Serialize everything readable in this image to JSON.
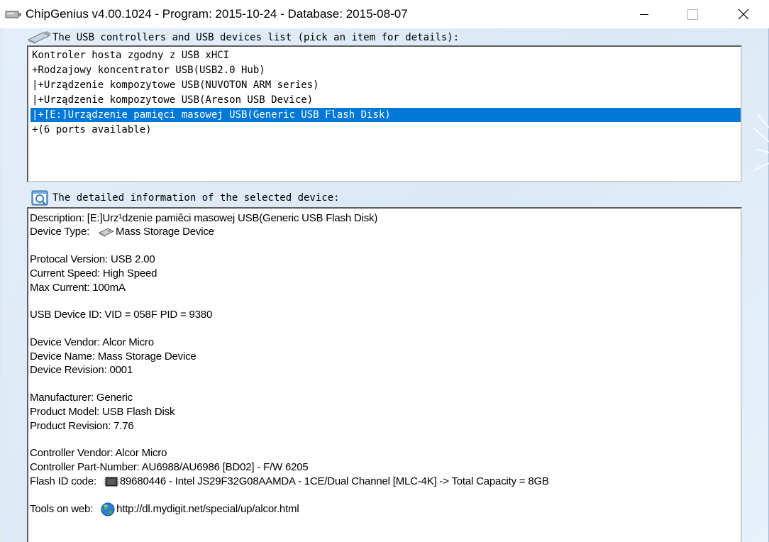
{
  "window": {
    "title": "ChipGenius v4.00.1024 - Program: 2015-10-24 - Database: 2015-08-07"
  },
  "list_section": {
    "label": "The USB controllers and USB devices list (pick an item for details):",
    "items": [
      "Kontroler hosta zgodny z USB xHCI",
      "+Rodzajowy koncentrator USB(USB2.0 Hub)",
      "|+Urządzenie kompozytowe USB(NUVOTON ARM series)",
      "|+Urządzenie kompozytowe USB(Areson USB Device)",
      "|+[E:]Urządzenie pamięci masowej USB(Generic USB Flash Disk)",
      "+(6 ports available)"
    ],
    "selected_index": 4
  },
  "detail_section": {
    "label": "The detailed information of the selected device:",
    "lines": {
      "description": "Description: [E:]Urz¹dzenie pamiêci masowej USB(Generic USB Flash Disk)",
      "device_type_label": "Device Type:",
      "device_type_value": "Mass Storage Device",
      "protocol_version": "Protocal Version: USB 2.00",
      "current_speed": "Current Speed: High Speed",
      "max_current": "Max Current: 100mA",
      "usb_device_id": "USB Device ID: VID = 058F PID = 9380",
      "device_vendor": "Device Vendor: Alcor Micro",
      "device_name": "Device Name: Mass Storage Device",
      "device_revision": "Device Revision: 0001",
      "manufacturer": "Manufacturer: Generic",
      "product_model": "Product Model: USB Flash Disk",
      "product_revision": "Product Revision: 7.76",
      "controller_vendor": "Controller Vendor: Alcor Micro",
      "controller_part_number": "Controller Part-Number: AU6988/AU6986 [BD02] - F/W 6205",
      "flash_id_label": "Flash ID code:",
      "flash_id_value": "89680446 - Intel JS29F32G08AAMDA - 1CE/Dual Channel [MLC-4K] -> Total Capacity = 8GB",
      "tools_label": "Tools on web:",
      "tools_link": "http://dl.mydigit.net/special/up/alcor.html"
    }
  },
  "colors": {
    "selection": "#0078d7",
    "client_bg": "#dbe8f5"
  },
  "icons": [
    "usb-drive-icon",
    "info-search-icon",
    "mass-storage-icon",
    "chip-icon",
    "globe-icon",
    "minimize-icon",
    "maximize-icon",
    "close-icon"
  ]
}
